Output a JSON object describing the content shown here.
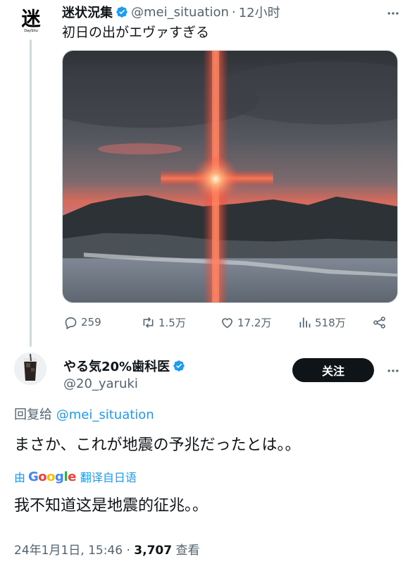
{
  "parent_tweet": {
    "author_name": "迷状況集",
    "avatar_glyph": "迷",
    "avatar_sub": "DaySitu",
    "handle": "@mei_situation",
    "separator": "·",
    "time": "12小时",
    "text": "初日の出がエヴァすぎる",
    "photo_alt": "sunrise cross of light over mountains and sea",
    "actions": {
      "replies": "259",
      "retweets": "1.5万",
      "likes": "17.2万",
      "views": "518万"
    }
  },
  "reply_tweet": {
    "author_name": "やる気20%歯科医",
    "handle": "@20_yaruki",
    "follow_label": "关注",
    "reply_to_prefix": "回复给",
    "reply_to_handle": "@mei_situation",
    "text": "まさか、これが地震の予兆だったとは。。",
    "translate_prefix": "由",
    "translate_suffix": "翻译自日语",
    "translated_text": "我不知道这是地震的征兆。。",
    "timestamp": "24年1月1日, 15:46",
    "meta_separator": "·",
    "view_count": "3,707",
    "view_label": "查看"
  },
  "colors": {
    "accent": "#1d9bf0",
    "text": "#0f1419",
    "secondary_text": "#536471",
    "follow_button_bg": "#0f1419"
  },
  "icons": [
    "reply-icon",
    "retweet-icon",
    "like-icon",
    "views-icon",
    "share-icon",
    "more-icon",
    "verified-icon"
  ]
}
